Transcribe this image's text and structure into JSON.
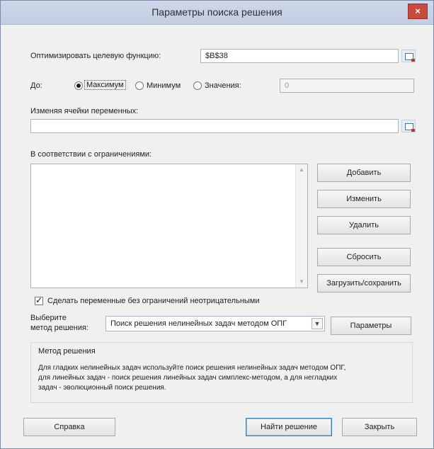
{
  "dialog": {
    "title": "Параметры поиска решения",
    "close_glyph": "×"
  },
  "objective": {
    "label": "Оптимизировать целевую функцию:",
    "value": "$B$38"
  },
  "to": {
    "label": "До:",
    "options": [
      "Максимум",
      "Минимум",
      "Значения:"
    ],
    "selected": "Максимум",
    "value_field": "0"
  },
  "variables": {
    "label": "Изменяя ячейки переменных:",
    "value": ""
  },
  "constraints": {
    "label": "В соответствии с ограничениями:",
    "items": [],
    "buttons": {
      "add": "Добавить",
      "change": "Изменить",
      "delete": "Удалить",
      "reset": "Сбросить",
      "load_save": "Загрузить/сохранить"
    }
  },
  "nonnegative": {
    "label": "Сделать переменные без ограничений неотрицательными",
    "checked": true
  },
  "method": {
    "label_line1": "Выберите",
    "label_line2": "метод решения:",
    "selected": "Поиск решения нелинейных задач методом ОПГ",
    "options_button": "Параметры"
  },
  "method_description": {
    "title": "Метод решения",
    "line1": "Для гладких нелинейных задач используйте поиск решения нелинейных задач методом ОПГ,",
    "line2": "для линейных задач - поиск решения линейных задач симплекс-методом, а для негладких",
    "line3": "задач - эволюционный поиск решения."
  },
  "footer": {
    "help": "Справка",
    "solve": "Найти решение",
    "close": "Закрыть"
  }
}
